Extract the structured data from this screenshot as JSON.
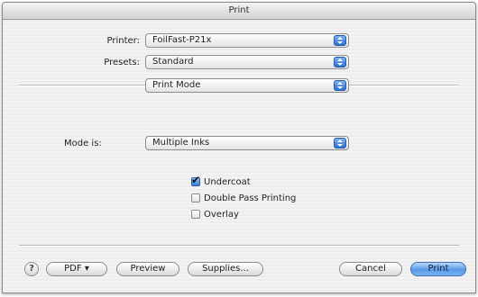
{
  "window": {
    "title": "Print"
  },
  "printer": {
    "label": "Printer:",
    "value": "FoilFast-P21x"
  },
  "presets": {
    "label": "Presets:",
    "value": "Standard"
  },
  "panel": {
    "value": "Print Mode"
  },
  "mode": {
    "label": "Mode is:",
    "value": "Multiple Inks"
  },
  "options": [
    {
      "label": "Undercoat",
      "checked": true
    },
    {
      "label": "Double Pass Printing",
      "checked": false
    },
    {
      "label": "Overlay",
      "checked": false
    }
  ],
  "footer": {
    "help": "?",
    "pdf": "PDF ▾",
    "preview": "Preview",
    "supplies": "Supplies...",
    "cancel": "Cancel",
    "print": "Print"
  },
  "colors": {
    "accent": "#3a7fd8",
    "window_bg": "#ececec"
  }
}
